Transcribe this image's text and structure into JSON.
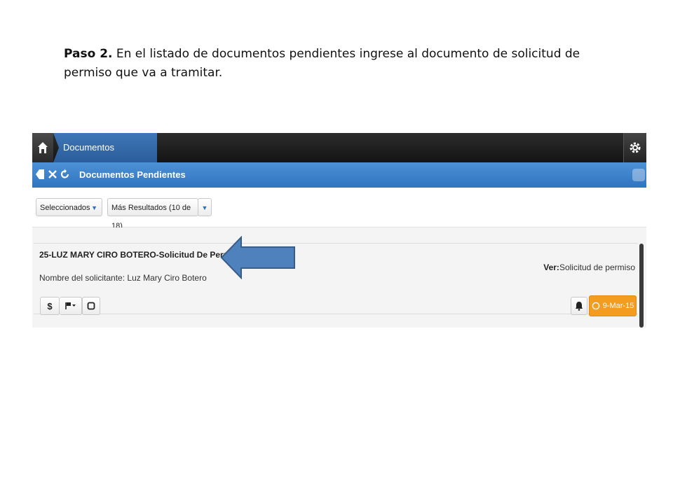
{
  "instruction": {
    "step_label": "Paso 2.",
    "text": " En el listado de documentos pendientes ingrese al documento de solicitud de permiso que va a tramitar."
  },
  "topbar": {
    "home_icon": "home-icon",
    "breadcrumb_label": "Documentos Pendientes",
    "settings_icon": "gear-icon"
  },
  "header": {
    "title": "Documentos Pendientes",
    "icons": [
      "back-icon",
      "close-icon",
      "refresh-icon"
    ]
  },
  "toolbar": {
    "filter_label": "Seleccionados",
    "results_label": "Más Resultados (10 de 18)"
  },
  "document": {
    "title": "25-LUZ MARY CIRO BOTERO-Solicitud De Permiso",
    "requester": "Nombre del solicitante: Luz Mary Ciro Botero",
    "view_label": "Ver:",
    "view_value": "Solicitud de permiso",
    "dollar_button": "$",
    "date": "9-Mar-15"
  },
  "colors": {
    "accent_blue": "#2f74c0",
    "date_orange": "#f39c1f",
    "arrow_blue": "#4f81bd"
  }
}
